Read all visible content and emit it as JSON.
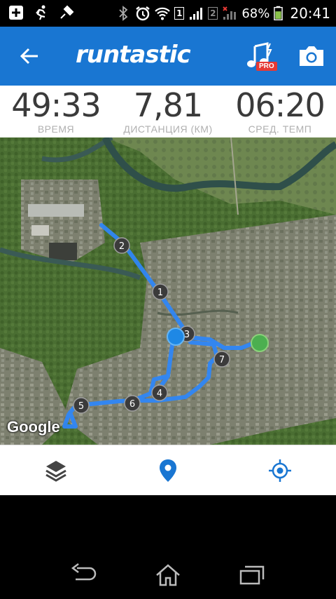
{
  "status_bar": {
    "sim1": "1",
    "sim2": "2",
    "battery": "68%",
    "time": "20:41"
  },
  "app_bar": {
    "logo": "runtastic",
    "pro_badge": "PRO",
    "icons": [
      "arrow-back-icon",
      "music-pro-icon",
      "camera-icon"
    ],
    "color": "#1976d2"
  },
  "stats": [
    {
      "value": "49:33",
      "label": "ВРЕМЯ"
    },
    {
      "value": "7,81",
      "label": "ДИСТАНЦИЯ (КМ)"
    },
    {
      "value": "06:20",
      "label": "СРЕД. ТЕМП"
    }
  ],
  "map": {
    "attribution": "Google",
    "route_color": "#2f86f5",
    "markers": [
      "1",
      "2",
      "3",
      "4",
      "5",
      "6",
      "7"
    ],
    "start_color": "#4caf50",
    "end_color": "#1e88e5"
  },
  "bottom_tabs": {
    "icons": [
      "layers-icon",
      "map-pin-icon",
      "my-location-icon"
    ],
    "active_color": "#1976d2"
  },
  "nav_bar": {
    "icons": [
      "back-nav-icon",
      "home-nav-icon",
      "recents-nav-icon"
    ]
  }
}
